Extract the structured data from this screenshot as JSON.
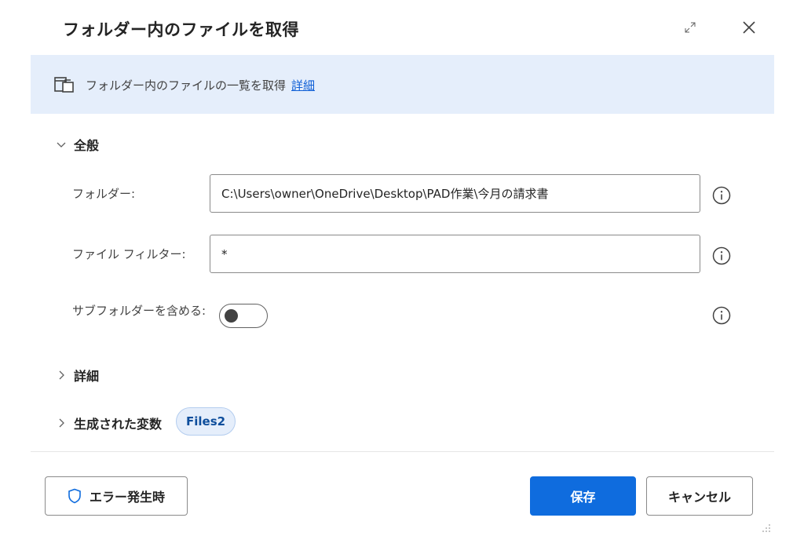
{
  "dialog": {
    "title": "フォルダー内のファイルを取得"
  },
  "banner": {
    "icon": "folder-files-icon",
    "text": "フォルダー内のファイルの一覧を取得",
    "link": "詳細"
  },
  "general": {
    "section_label": "全般",
    "folder": {
      "label": "フォルダー:",
      "value": "C:\\Users\\owner\\OneDrive\\Desktop\\PAD作業\\今月の請求書"
    },
    "file_filter": {
      "label": "ファイル フィルター:",
      "value": "*"
    },
    "include_subfolders": {
      "label": "サブフォルダーを含める:",
      "enabled": false
    }
  },
  "details": {
    "section_label": "詳細"
  },
  "variables": {
    "section_label": "生成された変数",
    "badge": "Files2"
  },
  "footer": {
    "on_error_label": "エラー発生時",
    "save_label": "保存",
    "cancel_label": "キャンセル"
  },
  "colors": {
    "accent": "#0f6cde",
    "banner_bg": "#e5eefb",
    "link": "#0f5fd6"
  }
}
